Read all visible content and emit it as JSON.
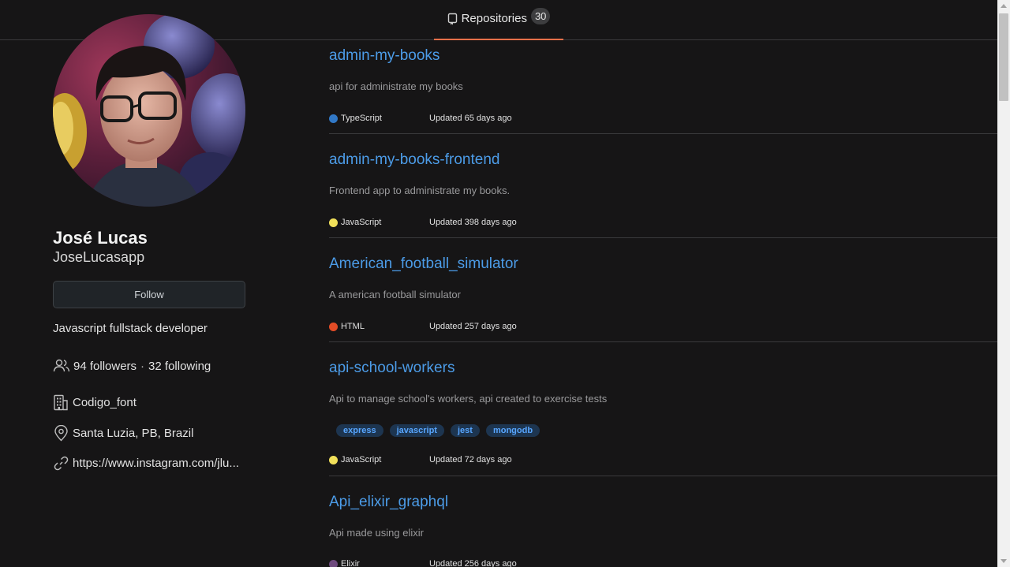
{
  "nav": {
    "tab_label": "Repositories",
    "tab_count": "30",
    "accent": "#f0704a"
  },
  "profile": {
    "fullname": "José Lucas",
    "username": "JoseLucasapp",
    "follow_label": "Follow",
    "bio": "Javascript fullstack developer",
    "followers": "94 followers",
    "separator": "·",
    "following": "32 following",
    "company": "Codigo_font",
    "location": "Santa Luzia, PB, Brazil",
    "website": "https://www.instagram.com/jlu..."
  },
  "repos": [
    {
      "name": "admin-my-books",
      "description": "api for administrate my books",
      "language": "TypeScript",
      "lang_color": "#3178c6",
      "updated": "Updated 65 days ago",
      "topics": []
    },
    {
      "name": "admin-my-books-frontend",
      "description": "Frontend app to administrate my books.",
      "language": "JavaScript",
      "lang_color": "#f1e05a",
      "updated": "Updated 398 days ago",
      "topics": []
    },
    {
      "name": "American_football_simulator",
      "description": "A american football simulator",
      "language": "HTML",
      "lang_color": "#e34c26",
      "updated": "Updated 257 days ago",
      "topics": []
    },
    {
      "name": "api-school-workers",
      "description": "Api to manage school's workers, api created to exercise tests",
      "language": "JavaScript",
      "lang_color": "#f1e05a",
      "updated": "Updated 72 days ago",
      "topics": [
        "express",
        "javascript",
        "jest",
        "mongodb"
      ]
    },
    {
      "name": "Api_elixir_graphql",
      "description": "Api made using elixir",
      "language": "Elixir",
      "lang_color": "#6e4a7e",
      "updated": "Updated 256 days ago",
      "topics": []
    }
  ]
}
